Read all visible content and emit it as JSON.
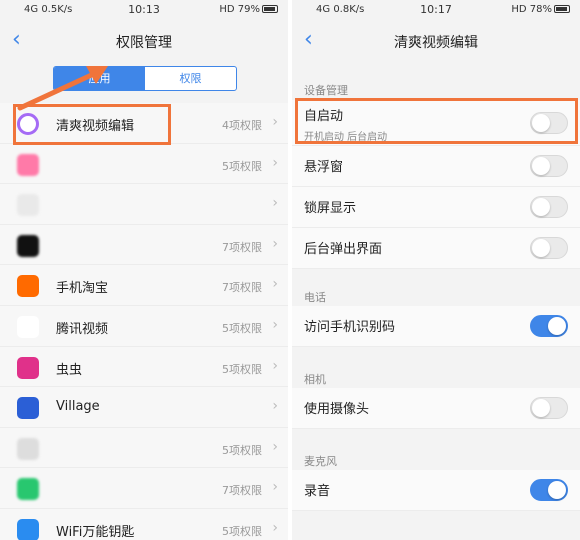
{
  "left": {
    "status": {
      "network": "4G",
      "speed": "0.5K/s",
      "time": "10:13",
      "hd": "HD",
      "battery": "79%"
    },
    "title": "权限管理",
    "tabs": [
      "应用",
      "权限"
    ],
    "apps": [
      {
        "name": "清爽视频编辑",
        "permissions": "4项权限",
        "color": "#a56bf5"
      },
      {
        "name": "",
        "permissions": "5项权限",
        "color": "#ff7aa8"
      },
      {
        "name": "",
        "permissions": "",
        "color": "#e9e9e9"
      },
      {
        "name": "",
        "permissions": "7项权限",
        "color": "#111111"
      },
      {
        "name": "手机淘宝",
        "permissions": "7项权限",
        "color": "#ff6a00"
      },
      {
        "name": "腾讯视频",
        "permissions": "5项权限",
        "color": "#ffffff"
      },
      {
        "name": "虫虫",
        "permissions": "5项权限",
        "color": "#e0318a"
      },
      {
        "name": "Village",
        "permissions": "",
        "color": "#2b5fd6"
      },
      {
        "name": "",
        "permissions": "5项权限",
        "color": "#dddddd"
      },
      {
        "name": "",
        "permissions": "7项权限",
        "color": "#28c76f"
      },
      {
        "name": "WiFi万能钥匙",
        "permissions": "5项权限",
        "color": "#2a8cf0"
      }
    ]
  },
  "right": {
    "status": {
      "network": "4G",
      "speed": "0.8K/s",
      "time": "10:17",
      "hd": "HD",
      "battery": "78%"
    },
    "title": "清爽视频编辑",
    "groups": [
      {
        "title": "设备管理",
        "items": [
          {
            "label": "自启动",
            "sub": "开机启动  后台启动",
            "on": false
          },
          {
            "label": "悬浮窗",
            "sub": "",
            "on": false
          },
          {
            "label": "锁屏显示",
            "sub": "",
            "on": false
          },
          {
            "label": "后台弹出界面",
            "sub": "",
            "on": false
          }
        ]
      },
      {
        "title": "电话",
        "items": [
          {
            "label": "访问手机识别码",
            "sub": "",
            "on": true
          }
        ]
      },
      {
        "title": "相机",
        "items": [
          {
            "label": "使用摄像头",
            "sub": "",
            "on": false
          }
        ]
      },
      {
        "title": "麦克风",
        "items": [
          {
            "label": "录音",
            "sub": "",
            "on": true
          }
        ]
      }
    ]
  },
  "colors": {
    "accent": "#3f86e8",
    "highlight": "#f0743b"
  },
  "icons": {
    "back": "back-chevron-icon",
    "row_chevron": "chevron-right-icon"
  }
}
